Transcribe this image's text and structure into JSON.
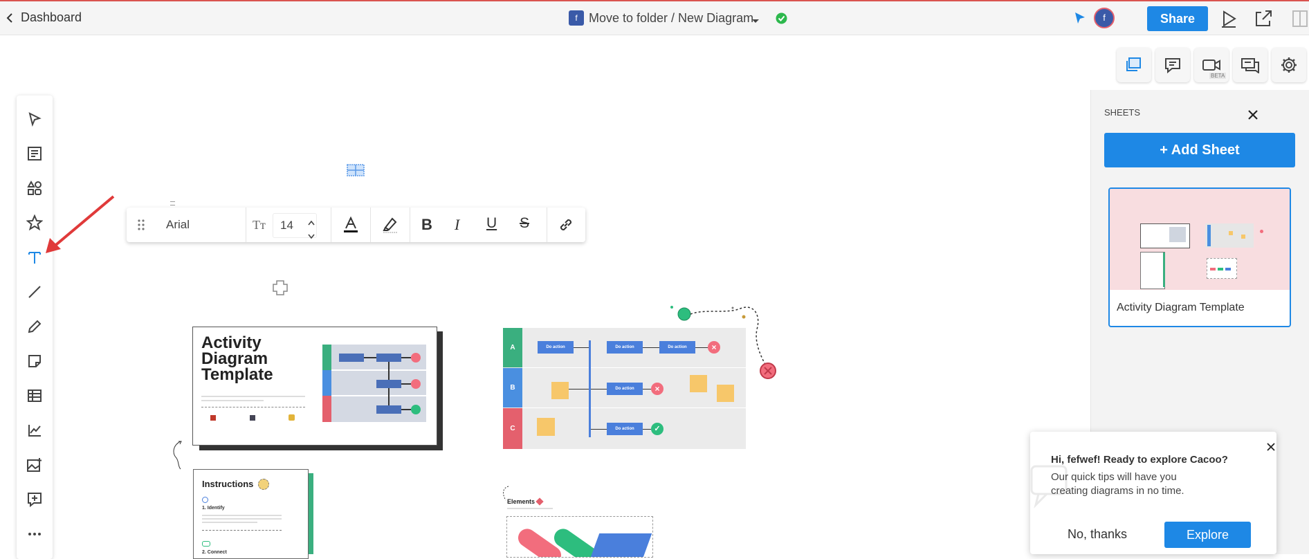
{
  "topbar": {
    "back_label": "Dashboard",
    "folder_badge": "f",
    "title": "Move to folder / New Diagram",
    "avatar_letter": "f",
    "share_label": "Share"
  },
  "right_tools": {
    "beta_label": "BETA"
  },
  "text_toolbar": {
    "font_name": "Arial",
    "font_size": "14"
  },
  "sheets_panel": {
    "heading": "SHEETS",
    "add_sheet_label": "+ Add Sheet",
    "sheet_name": "Activity Diagram Template"
  },
  "canvas": {
    "template_title_line1": "Activity",
    "template_title_line2": "Diagram",
    "template_title_line3": "Template",
    "lane_a": "A",
    "lane_b": "B",
    "lane_c": "C",
    "action_label": "Do action",
    "instructions_title": "Instructions",
    "instructions_step1": "1. Identify",
    "instructions_step2": "2. Connect",
    "elements_title": "Elements"
  },
  "popup": {
    "title": "Hi, fefwef! Ready to explore Cacoo?",
    "body": "Our quick tips will have you creating diagrams in no time.",
    "decline_label": "No, thanks",
    "accept_label": "Explore"
  },
  "colors": {
    "accent_blue": "#1e88e5",
    "template_pink": "#f8dde0",
    "lane_green": "#3aaf7f",
    "lane_blue": "#4a8fe0",
    "lane_red": "#e4606d",
    "action_blue": "#4a7fdc",
    "sticky_yellow": "#f7c76a",
    "stop_red": "#f26d7d",
    "done_green": "#2dbd7e"
  }
}
